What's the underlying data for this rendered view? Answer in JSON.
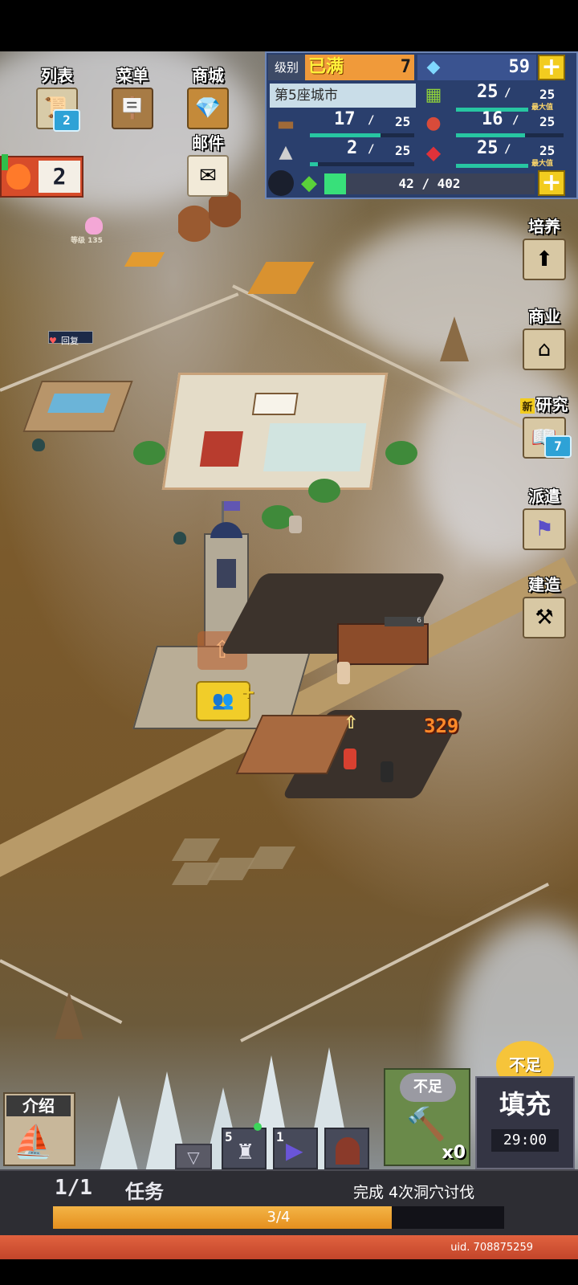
{
  "menu": {
    "list_label": "列表",
    "list_badge": "2",
    "menu_label": "菜单",
    "shop_label": "商城",
    "mail_label": "邮件"
  },
  "stamina": {
    "count": "2"
  },
  "status": {
    "rank_label": "级别",
    "rank_value": "已满",
    "rank_number": "7",
    "gems": "59",
    "city_name": "第5座城市",
    "resources": [
      {
        "icon": "grass-icon",
        "current": "25",
        "max": "25",
        "max_note": "最大值",
        "fill": 1.0
      },
      {
        "icon": "wood-icon",
        "current": "17",
        "max": "25",
        "fill": 0.68
      },
      {
        "icon": "food-icon",
        "current": "16",
        "max": "25",
        "fill": 0.64
      },
      {
        "icon": "ore-icon",
        "current": "2",
        "max": "25",
        "fill": 0.08
      },
      {
        "icon": "ruby-icon",
        "current": "25",
        "max": "25",
        "max_note": "最大值",
        "fill": 1.0
      }
    ],
    "exp_text": "42 / 402",
    "exp_fill": 0.104
  },
  "side": {
    "train_label": "培养",
    "business_label": "商业",
    "research_new": "新",
    "research_label": "研究",
    "research_badge": "7",
    "dispatch_label": "派遣",
    "build_label": "建造"
  },
  "world": {
    "rabbit_level": "等级 135",
    "recover_label": "回复",
    "damage_number": "329",
    "stall_count": "6"
  },
  "bottom": {
    "intro_label": "介绍",
    "tool1_count": "5",
    "tool2_count": "1",
    "insufficient_label": "不足",
    "hammer_count": "x0",
    "fill_label": "填充",
    "fill_badge": "不足",
    "timer": "29:00"
  },
  "quest": {
    "progress_label": "1/1",
    "title": "任务",
    "description": "完成 4次洞穴讨伐",
    "progress_text": "3/4",
    "progress_fill": 0.75
  },
  "uid": "uid. 708875259",
  "colors": {
    "accent_orange": "#f0a030",
    "panel_blue": "#2a3f6d",
    "bar_green": "#27c6a2"
  }
}
